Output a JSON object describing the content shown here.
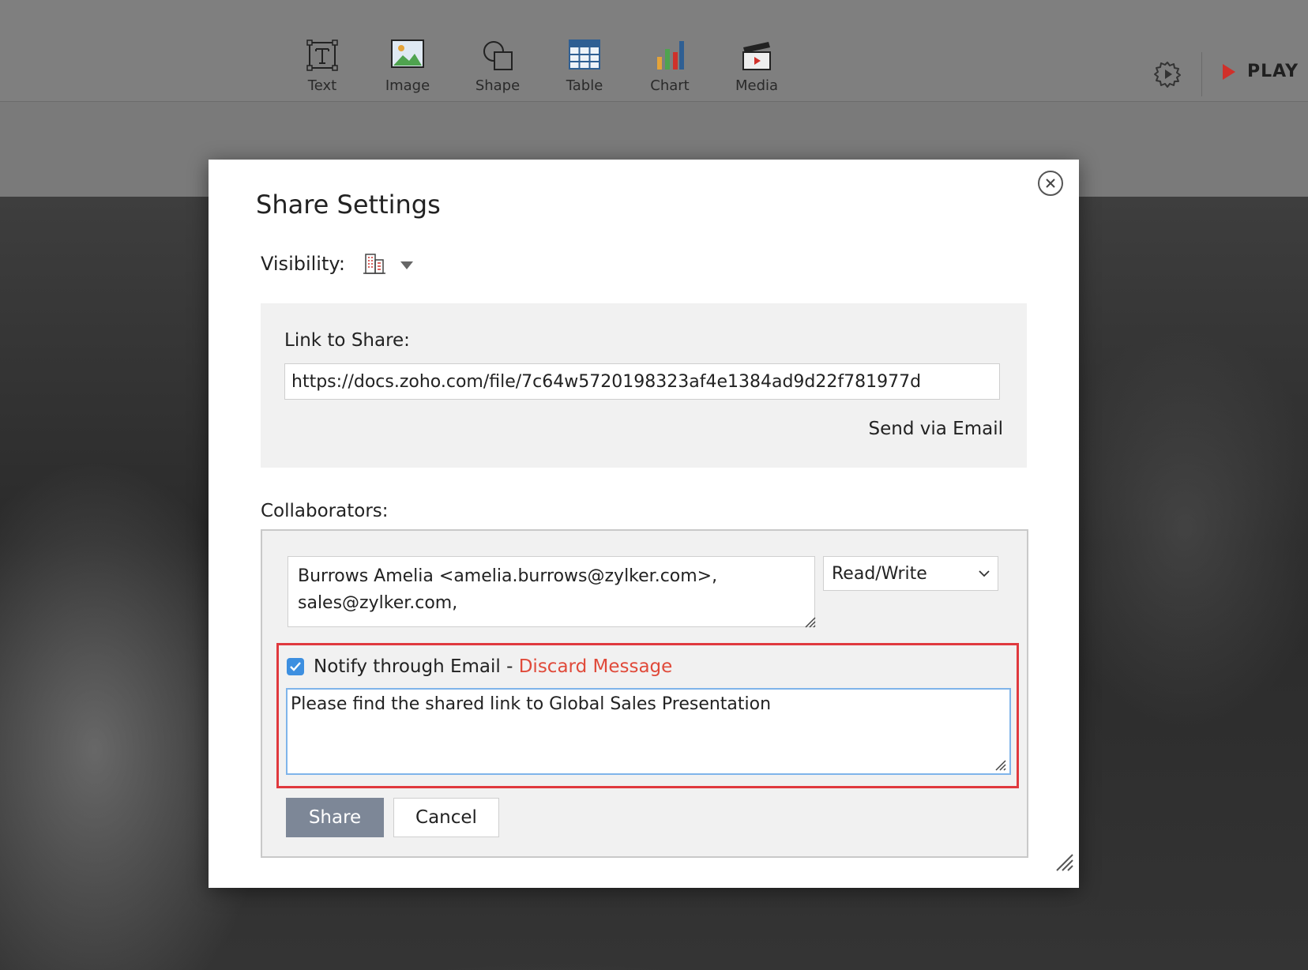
{
  "toolbar": {
    "tools": [
      {
        "label": "Text",
        "icon": "text-icon"
      },
      {
        "label": "Image",
        "icon": "image-icon"
      },
      {
        "label": "Shape",
        "icon": "shape-icon"
      },
      {
        "label": "Table",
        "icon": "table-icon"
      },
      {
        "label": "Chart",
        "icon": "chart-icon"
      },
      {
        "label": "Media",
        "icon": "media-icon"
      }
    ],
    "play_label": "PLAY",
    "settings_icon": "gear-icon"
  },
  "dialog": {
    "title": "Share Settings",
    "visibility_label": "Visibility:",
    "visibility_icon": "organization-icon",
    "link_label": "Link to Share:",
    "link_value": "https://docs.zoho.com/file/7c64w5720198323af4e1384ad9d22f781977d",
    "send_email_label": "Send via Email",
    "collaborators_label": "Collaborators:",
    "recipients_value": "Burrows Amelia <amelia.burrows@zylker.com>,\nsales@zylker.com,",
    "permission_value": "Read/Write",
    "notify_checked": true,
    "notify_label": "Notify through Email - ",
    "discard_label": "Discard Message",
    "message_value": "Please find the shared link to Global Sales Presentation",
    "share_label": "Share",
    "cancel_label": "Cancel"
  },
  "colors": {
    "accent_red": "#e0393e",
    "discard_link": "#e04a3a",
    "checkbox_blue": "#3d8fe0",
    "share_button": "#7d8797",
    "play_red": "#d0302a"
  }
}
